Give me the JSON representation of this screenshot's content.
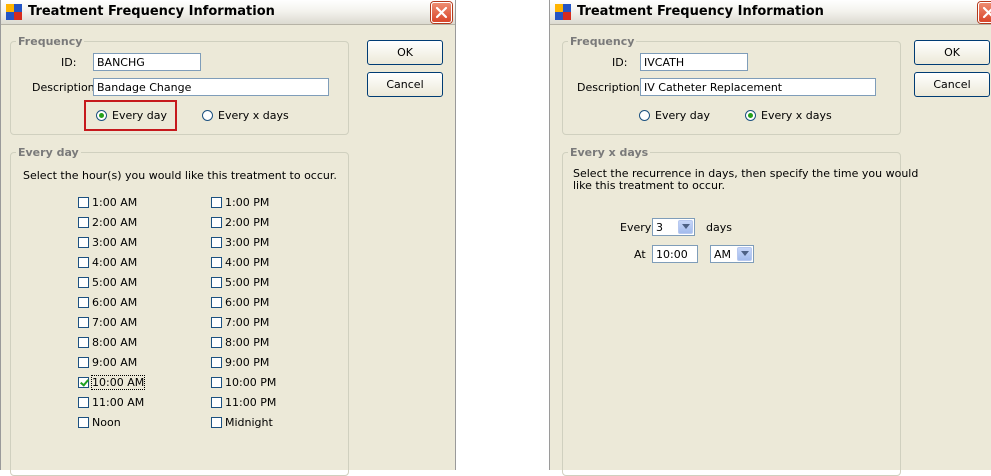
{
  "dialog1": {
    "title": "Treatment Frequency Information",
    "frequency_group": "Frequency",
    "id_label": "ID:",
    "id_value": "BANCHG",
    "description_label": "Description:",
    "description_value": "Bandage Change",
    "radio_every_day": "Every day",
    "radio_every_x_days": "Every x days",
    "selected_radio": "Every day",
    "ok_label": "OK",
    "cancel_label": "Cancel",
    "every_day_group": "Every day",
    "instruction": "Select the hour(s) you would like this treatment to occur.",
    "am_hours": [
      {
        "label": "1:00 AM",
        "checked": false
      },
      {
        "label": "2:00 AM",
        "checked": false
      },
      {
        "label": "3:00 AM",
        "checked": false
      },
      {
        "label": "4:00 AM",
        "checked": false
      },
      {
        "label": "5:00 AM",
        "checked": false
      },
      {
        "label": "6:00 AM",
        "checked": false
      },
      {
        "label": "7:00 AM",
        "checked": false
      },
      {
        "label": "8:00 AM",
        "checked": false
      },
      {
        "label": "9:00 AM",
        "checked": false
      },
      {
        "label": "10:00 AM",
        "checked": true
      },
      {
        "label": "11:00 AM",
        "checked": false
      },
      {
        "label": "Noon",
        "checked": false
      }
    ],
    "pm_hours": [
      {
        "label": "1:00 PM",
        "checked": false
      },
      {
        "label": "2:00 PM",
        "checked": false
      },
      {
        "label": "3:00 PM",
        "checked": false
      },
      {
        "label": "4:00 PM",
        "checked": false
      },
      {
        "label": "5:00 PM",
        "checked": false
      },
      {
        "label": "6:00 PM",
        "checked": false
      },
      {
        "label": "7:00 PM",
        "checked": false
      },
      {
        "label": "8:00 PM",
        "checked": false
      },
      {
        "label": "9:00 PM",
        "checked": false
      },
      {
        "label": "10:00 PM",
        "checked": false
      },
      {
        "label": "11:00 PM",
        "checked": false
      },
      {
        "label": "Midnight",
        "checked": false
      }
    ]
  },
  "dialog2": {
    "title": "Treatment Frequency Information",
    "frequency_group": "Frequency",
    "id_label": "ID:",
    "id_value": "IVCATH",
    "description_label": "Description:",
    "description_value": "IV Catheter Replacement",
    "radio_every_day": "Every day",
    "radio_every_x_days": "Every x days",
    "selected_radio": "Every x days",
    "ok_label": "OK",
    "cancel_label": "Cancel",
    "every_x_group": "Every x days",
    "instruction_line1": "Select the recurrence in days, then specify the time you would",
    "instruction_line2": "like this treatment to occur.",
    "every_label": "Every",
    "every_value": "3",
    "days_label": "days",
    "at_label": "At",
    "time_value": "10:00",
    "ampm_value": "AM"
  },
  "colors": {
    "dialog_bg": "#ece9d8",
    "highlight": "#c6191d",
    "group_title": "#7a7a7a"
  }
}
